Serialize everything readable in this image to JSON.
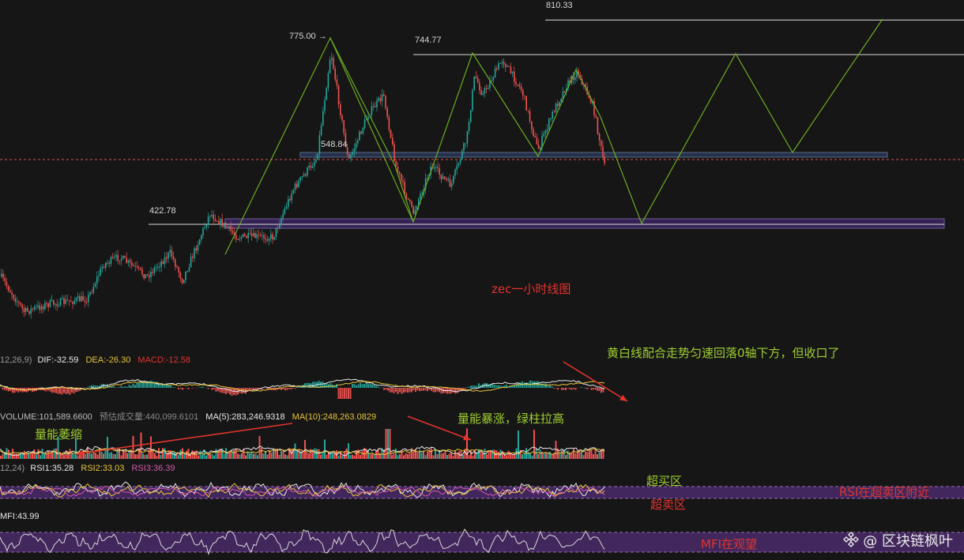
{
  "chart_data": {
    "type": "candlestick",
    "price_levels": [
      "810.33",
      "775.00",
      "744.77",
      "548.84",
      "422.78"
    ],
    "marker_arrow": "→",
    "macd": {
      "params": "12,26,9",
      "dif": "DIF:-32.59",
      "dea": "DEA:-26.30",
      "macd": "MACD:-12.58"
    },
    "volume": {
      "volume": "VOLUME:101,589.6600",
      "estimated": "预估成交量:440,099.6101",
      "ma5": "MA(5):283,246.9318",
      "ma10": "MA(10):248,263.0829"
    },
    "rsi": {
      "params": "12,24)",
      "rsi1": "RSI1:35.28",
      "rsi2": "RSI2:33.03",
      "rsi3": "RSI3:36.39"
    },
    "mfi": {
      "label": "MFI:43.99"
    },
    "annotations": {
      "title": "zec一小时线图",
      "macd_note": "黄白线配合走势匀速回落0轴下方，但收口了",
      "volume_shrink": "量能萎缩",
      "volume_surge": "量能暴涨，绿柱拉高",
      "overbought": "超买区",
      "oversold": "超卖区",
      "rsi_note": "RSI在超卖区附近",
      "mfi_note": "MFI在观望"
    },
    "colors": {
      "up": "#26a69a",
      "down": "#ef5350",
      "pattern": "#6aab22",
      "zone": "#4a2a6a",
      "background": "#161616"
    }
  },
  "watermark": {
    "text": "@ 区块链枫叶",
    "logo": "binance-square-logo"
  }
}
